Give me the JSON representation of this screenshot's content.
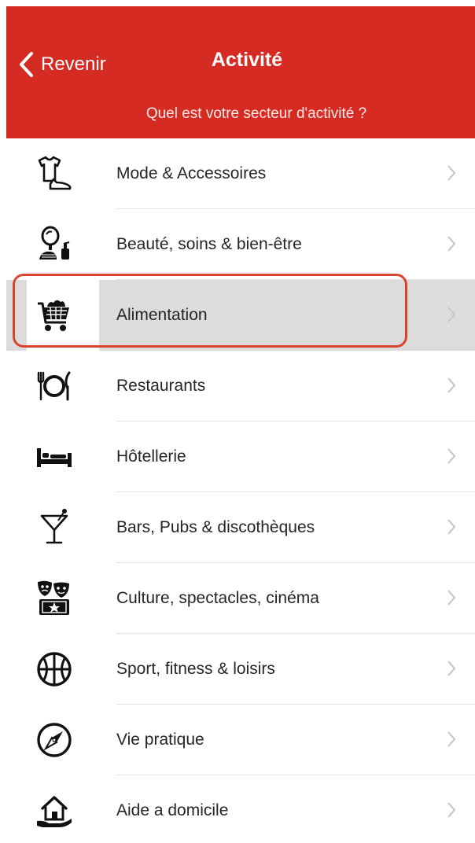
{
  "header": {
    "back_label": "Revenir",
    "title": "Activité",
    "subtitle": "Quel est votre secteur d'activité ?",
    "background_color": "#d62b22"
  },
  "categories": [
    {
      "label": "Mode & Accessoires",
      "icon": "tshirt-shoe-icon"
    },
    {
      "label": "Beauté, soins & bien-être",
      "icon": "mirror-comb-icon"
    },
    {
      "label": "Alimentation",
      "icon": "shopping-cart-icon",
      "selected": true
    },
    {
      "label": "Restaurants",
      "icon": "plate-cutlery-icon"
    },
    {
      "label": "Hôtellerie",
      "icon": "bed-icon"
    },
    {
      "label": "Bars, Pubs & discothèques",
      "icon": "cocktail-glass-icon"
    },
    {
      "label": "Culture, spectacles, cinéma",
      "icon": "theater-masks-ticket-icon"
    },
    {
      "label": "Sport, fitness & loisirs",
      "icon": "basketball-icon"
    },
    {
      "label": "Vie pratique",
      "icon": "compass-icon"
    },
    {
      "label": "Aide a domicile",
      "icon": "house-hand-icon"
    }
  ],
  "highlight_color": "#d9452c"
}
